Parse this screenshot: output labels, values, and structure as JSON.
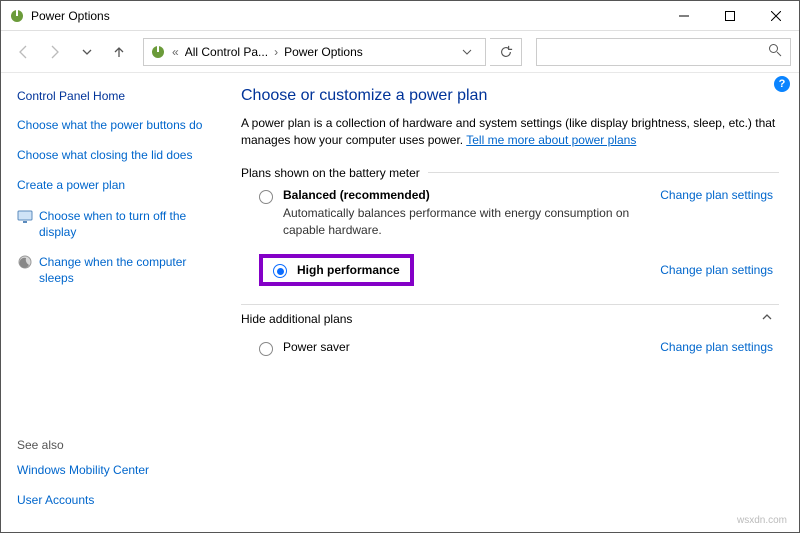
{
  "window": {
    "title": "Power Options"
  },
  "breadcrumb": {
    "back": "«",
    "item1": "All Control Pa...",
    "item2": "Power Options"
  },
  "sidebar": {
    "home": "Control Panel Home",
    "links": [
      "Choose what the power buttons do",
      "Choose what closing the lid does",
      "Create a power plan",
      "Choose when to turn off the display",
      "Change when the computer sleeps"
    ],
    "see_also": "See also",
    "see_links": [
      "Windows Mobility Center",
      "User Accounts"
    ]
  },
  "main": {
    "heading": "Choose or customize a power plan",
    "desc_a": "A power plan is a collection of hardware and system settings (like display brightness, sleep, etc.) that manages how your computer uses power. ",
    "desc_link": "Tell me more about power plans",
    "group1_legend": "Plans shown on the battery meter",
    "plan_balanced": {
      "name": "Balanced (recommended)",
      "sub": "Automatically balances performance with energy consumption on capable hardware."
    },
    "plan_high": {
      "name": "High performance"
    },
    "change": "Change plan settings",
    "hide_legend": "Hide additional plans",
    "plan_saver": {
      "name": "Power saver"
    }
  },
  "watermark": "wsxdn.com"
}
